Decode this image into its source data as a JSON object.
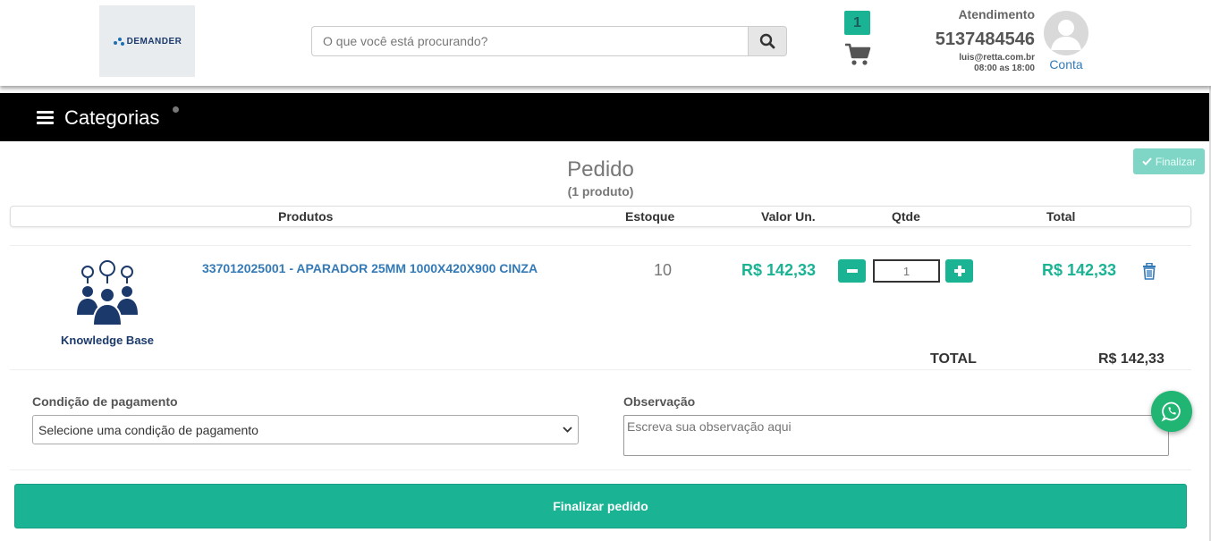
{
  "header": {
    "logo_text": "DEMANDER",
    "search_placeholder": "O que você está procurando?",
    "cart_count": "1",
    "atendimento": {
      "title": "Atendimento",
      "phone": "5137484546",
      "email": "luis@retta.com.br",
      "hours": "08:00 as 18:00"
    },
    "account_label": "Conta"
  },
  "navbar": {
    "categories_label": "Categorias"
  },
  "order": {
    "finalize_top_label": "Finalizar",
    "title": "Pedido",
    "subtitle": "(1 produto)",
    "columns": [
      "Produtos",
      "Estoque",
      "Valor Un.",
      "Qtde",
      "Total"
    ],
    "items": [
      {
        "image_label": "Knowledge Base",
        "name": "337012025001 - APARADOR 25MM 1000X420X900 CINZA",
        "stock": "10",
        "unit_price": "R$ 142,33",
        "quantity": "1",
        "total": "R$ 142,33"
      }
    ],
    "total_label": "TOTAL",
    "total_value": "R$ 142,33"
  },
  "payment": {
    "label": "Condição de pagamento",
    "selected": "Selecione uma condição de pagamento"
  },
  "observation": {
    "label": "Observação",
    "placeholder": "Escreva sua observação aqui"
  },
  "finalize_button_label": "Finalizar pedido",
  "colors": {
    "accent": "#1ab394",
    "link": "#337ab7",
    "navbar": "#000000",
    "whatsapp": "#20b572"
  }
}
